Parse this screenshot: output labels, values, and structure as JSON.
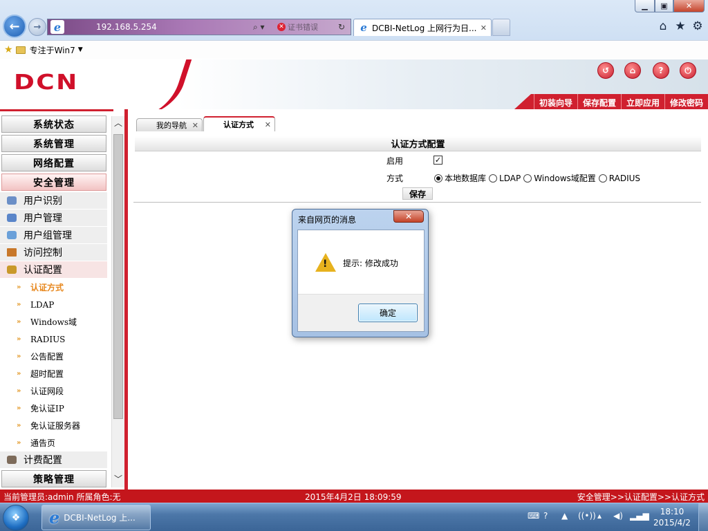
{
  "browser": {
    "window_controls": {
      "minimize": "▁",
      "maximize": "▣",
      "close": "✕"
    },
    "back_icon": "←",
    "forward_icon": "→",
    "address_icon": "e",
    "url": "192.168.5.254",
    "search_icon": "⌕ ▾",
    "cert_x": "✕",
    "cert_error": "证书错误",
    "refresh_icon": "↻",
    "tab": {
      "icon": "e",
      "title": "DCBI-NetLog 上网行为日...",
      "close": "✕"
    },
    "toolbar_icons": {
      "home": "⌂",
      "favorites": "★",
      "tools": "⚙"
    },
    "favorites_bar": {
      "star": "★",
      "label": "专注于Win7",
      "arrow": "▼"
    }
  },
  "header": {
    "logo": "DCN",
    "icons": [
      "logout-icon",
      "home-icon",
      "help-icon",
      "exit-icon"
    ],
    "icon_glyphs": {
      "logout": "↺",
      "home": "⌂",
      "help": "?",
      "exit": "⏻"
    },
    "actions": [
      "初装向导",
      "保存配置",
      "立即应用",
      "修改密码"
    ]
  },
  "sidebar": {
    "groups_top": [
      "系统状态",
      "系统管理",
      "网络配置",
      "安全管理"
    ],
    "items": [
      {
        "label": "用户识别",
        "color": "#6b8fc7"
      },
      {
        "label": "用户管理",
        "color": "#5a85c9"
      },
      {
        "label": "用户组管理",
        "color": "#6aa0d9"
      },
      {
        "label": "访问控制",
        "color": "#c8782a"
      },
      {
        "label": "认证配置",
        "color": "#c9992a"
      }
    ],
    "sub_arrow": "»",
    "subitems": [
      "认证方式",
      "LDAP",
      "Windows域",
      "RADIUS",
      "公告配置",
      "超时配置",
      "认证网段",
      "免认证IP",
      "免认证服务器",
      "通告页"
    ],
    "item_billing": {
      "label": "计费配置",
      "color": "#7d6b5a"
    },
    "group_bottom": "策略管理",
    "scroll_up": "︿",
    "scroll_down": "﹀"
  },
  "main": {
    "tabs": [
      "我的导航",
      "认证方式"
    ],
    "tab_close": "✕",
    "section_title": "认证方式配置",
    "enable_label": "启用",
    "enable_checked": "✓",
    "mode_label": "方式",
    "mode_options": [
      "本地数据库",
      "LDAP",
      "Windows域配置",
      "RADIUS"
    ],
    "selected_mode": "本地数据库",
    "save_label": "保存"
  },
  "dialog": {
    "title": "来自网页的消息",
    "close": "✕",
    "warning_mark": "!",
    "message": "提示: 修改成功",
    "ok_label": "确定"
  },
  "statusbar": {
    "admin": "当前管理员:admin  所属角色:无",
    "datetime": "2015年4月2日  18:09:59",
    "path": "安全管理>>认证配置>>认证方式"
  },
  "taskbar": {
    "start_glyph": "❖",
    "ie_icon": "e",
    "ie_label": "DCBI-NetLog 上...",
    "tray_glyphs": {
      "keyboard": "⌨",
      "help": "?",
      "up": "▲",
      "wifi": "((•))",
      "arrow": "▴",
      "sound": "◀)",
      "signal": "▂▄▆"
    },
    "time": "18:10",
    "date": "2015/4/2"
  }
}
